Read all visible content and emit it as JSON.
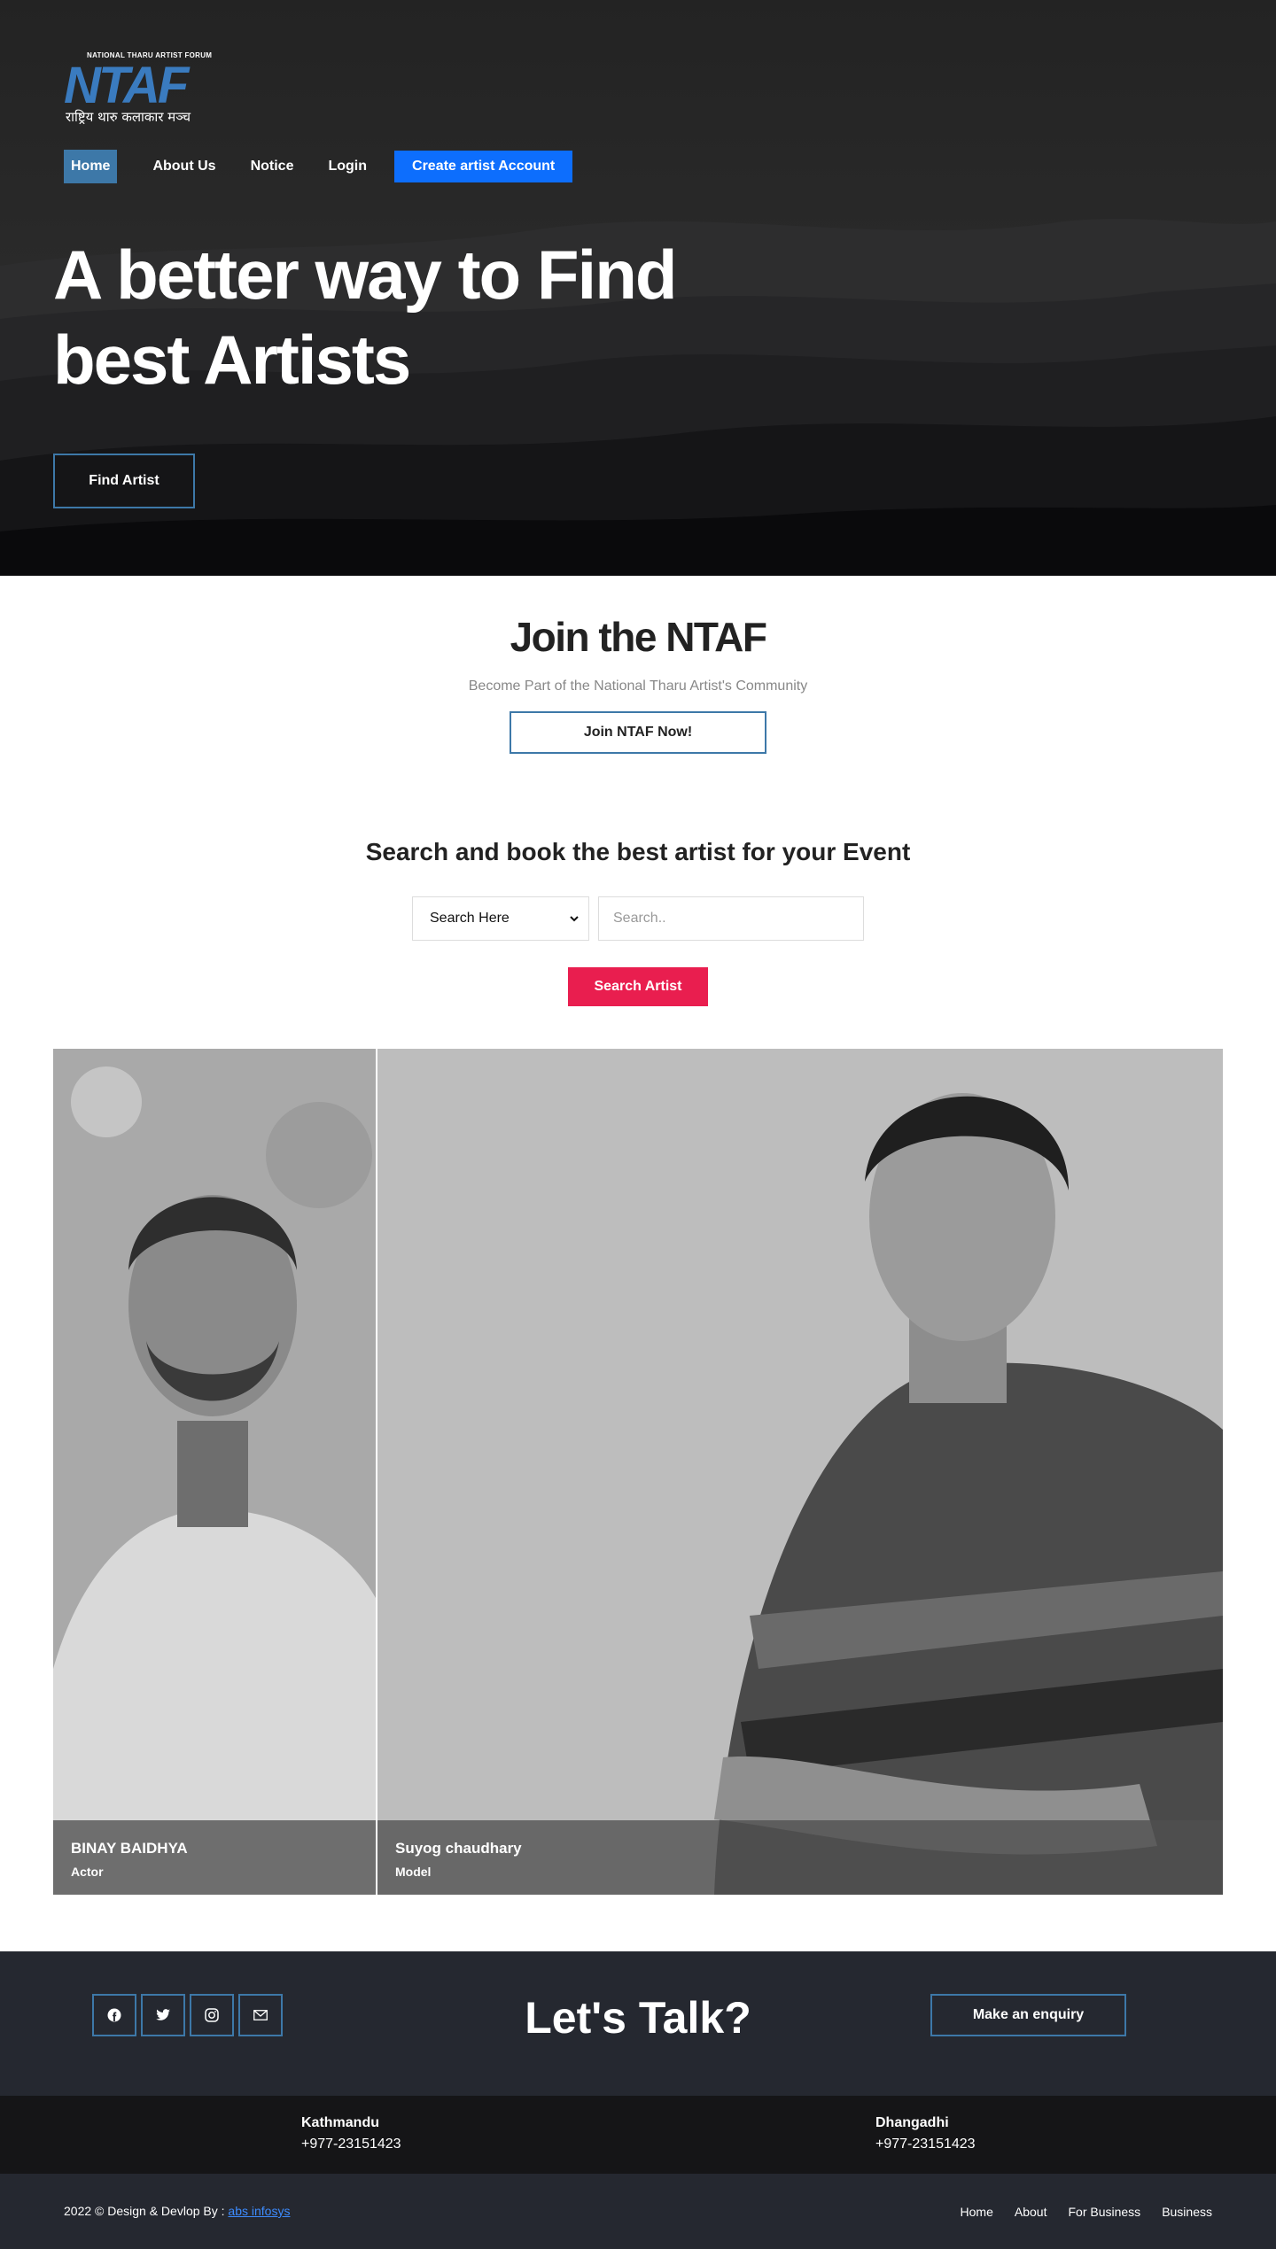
{
  "logo": {
    "top_text": "NATIONAL THARU ARTIST FORUM",
    "main_text": "NTAF",
    "sub_text": "राष्ट्रिय थारु कलाकार मञ्च"
  },
  "nav": {
    "items": [
      {
        "label": "Home",
        "active": true
      },
      {
        "label": "About Us",
        "active": false
      },
      {
        "label": "Notice",
        "active": false
      },
      {
        "label": "Login",
        "active": false
      }
    ],
    "cta_label": "Create artist Account"
  },
  "hero": {
    "title_line1": "A better way to Find",
    "title_line2": "best Artists",
    "button_label": "Find Artist"
  },
  "join": {
    "title": "Join the NTAF",
    "subtitle": "Become Part of the National Tharu Artist's Community",
    "button_label": "Join NTAF Now!"
  },
  "search": {
    "title": "Search and book the best artist for your Event",
    "select_value": "Search Here",
    "input_placeholder": "Search..",
    "button_label": "Search Artist"
  },
  "artists": [
    {
      "name": "BINAY BAIDHYA",
      "role": "Actor"
    },
    {
      "name": "Suyog chaudhary",
      "role": "Model"
    }
  ],
  "talk": {
    "title": "Let's Talk?",
    "enquiry_label": "Make an enquiry",
    "social_icons": [
      "facebook-icon",
      "twitter-icon",
      "instagram-icon",
      "mail-icon"
    ]
  },
  "addresses": [
    {
      "city": "Kathmandu",
      "phone": "+977-23151423"
    },
    {
      "city": "Dhangadhi",
      "phone": "+977-23151423"
    }
  ],
  "footer": {
    "copyright_prefix": "2022 © Design & Devlop By : ",
    "credit_link": "abs infosys",
    "links": [
      "Home",
      "About",
      "For Business",
      "Business"
    ]
  },
  "colors": {
    "accent_blue": "#3d78a8",
    "primary_blue": "#0d6efd",
    "search_red": "#e91e4f",
    "dark_bg": "#252830"
  }
}
